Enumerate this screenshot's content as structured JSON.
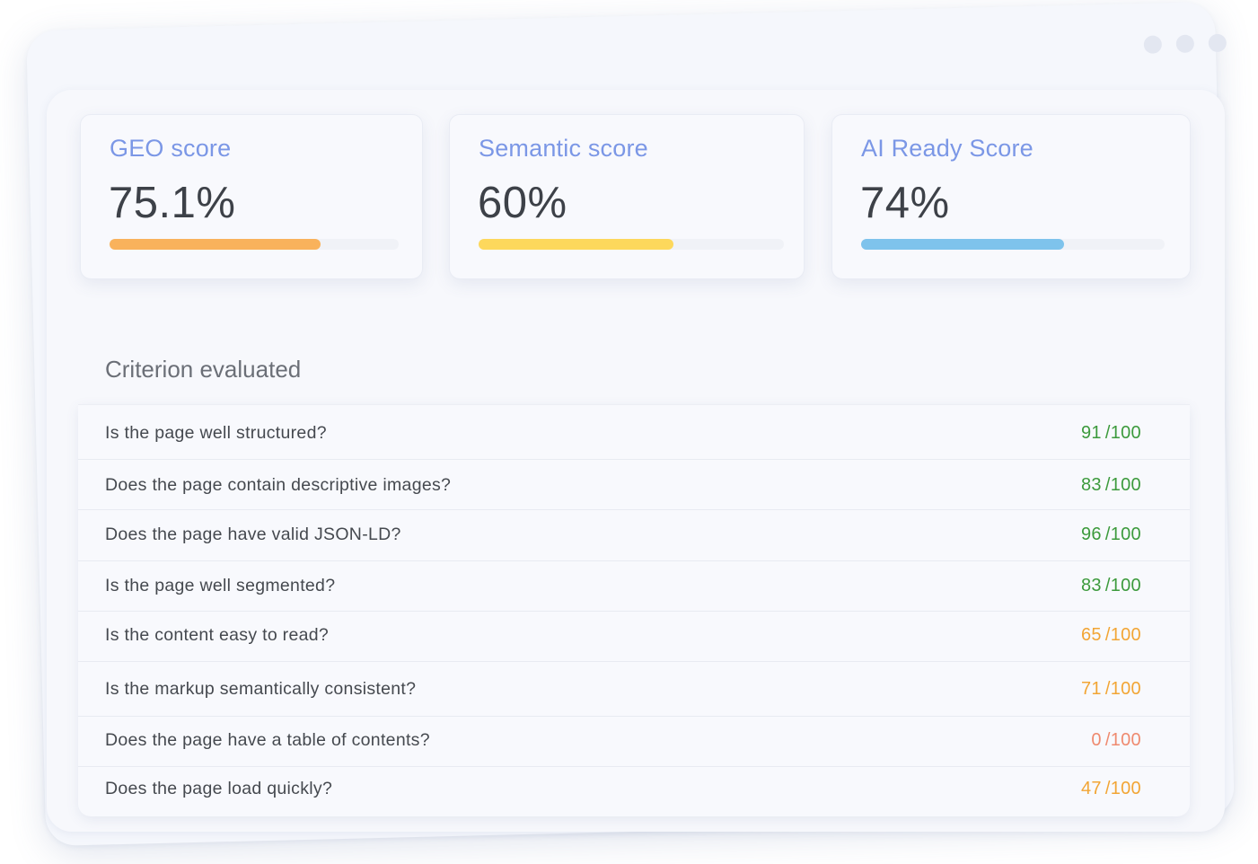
{
  "window": {
    "dots": 3,
    "colors": {
      "dot": "#e3e7f1"
    }
  },
  "cards": [
    {
      "title": "GEO score",
      "value": "75.1%",
      "progress": 0.731,
      "bar_color": "#f9b25c"
    },
    {
      "title": "Semantic score",
      "value": "60%",
      "progress": 0.637,
      "bar_color": "#fdd85c"
    },
    {
      "title": "AI Ready Score",
      "value": "74%",
      "progress": 0.67,
      "bar_color": "#7ec3ec"
    }
  ],
  "criteria": {
    "title": "Criterion evaluated",
    "colors": {
      "good": "#3c9a3c",
      "medium": "#f2a534",
      "bad": "#ef8a6f"
    },
    "rows": [
      {
        "label": "Is the page well structured?",
        "score": "91",
        "max": "/100",
        "level": "good"
      },
      {
        "label": "Does the page contain descriptive images?",
        "score": "83",
        "max": "/100",
        "level": "good"
      },
      {
        "label": "Does the page have valid JSON-LD?",
        "score": "96",
        "max": "/100",
        "level": "good"
      },
      {
        "label": "Is the page well segmented?",
        "score": "83",
        "max": "/100",
        "level": "good"
      },
      {
        "label": "Is the content easy to read?",
        "score": "65",
        "max": "/100",
        "level": "medium"
      },
      {
        "label": "Is the markup semantically consistent?",
        "score": "71",
        "max": "/100",
        "level": "medium"
      },
      {
        "label": "Does the page have a table of contents?",
        "score": "0",
        "max": "/100",
        "level": "bad"
      },
      {
        "label": "Does the page load quickly?",
        "score": "47",
        "max": "/100",
        "level": "medium"
      }
    ]
  }
}
